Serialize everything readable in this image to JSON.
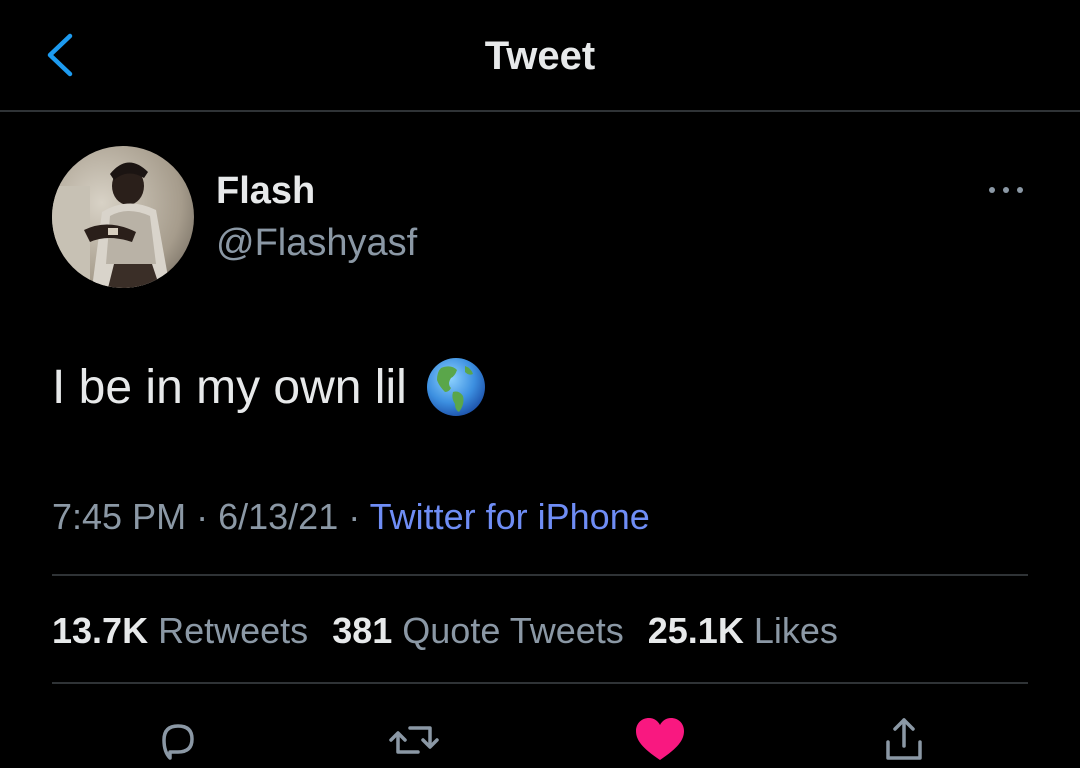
{
  "header": {
    "title": "Tweet",
    "back_icon": "chevron-left-icon"
  },
  "colors": {
    "background": "#000000",
    "text_primary": "#e7e9ea",
    "text_secondary": "#8b98a5",
    "link": "#6f8df5",
    "accent": "#1d9bf0",
    "like": "#f91880",
    "divider": "#2f3336"
  },
  "tweet": {
    "author": {
      "name": "Flash",
      "handle": "@Flashyasf"
    },
    "text": "I be in my own lil",
    "emoji": "globe-americas-emoji",
    "time": "7:45 PM",
    "separator": "·",
    "date": "6/13/21",
    "source": "Twitter for iPhone"
  },
  "stats": {
    "retweets_count": "13.7K",
    "retweets_label": "Retweets",
    "quotes_count": "381",
    "quotes_label": "Quote Tweets",
    "likes_count": "25.1K",
    "likes_label": "Likes"
  },
  "actions": [
    {
      "name": "reply",
      "icon": "reply-bubble-icon"
    },
    {
      "name": "retweet",
      "icon": "retweet-icon"
    },
    {
      "name": "like",
      "icon": "heart-filled-icon",
      "active": true
    },
    {
      "name": "share",
      "icon": "share-icon"
    }
  ]
}
